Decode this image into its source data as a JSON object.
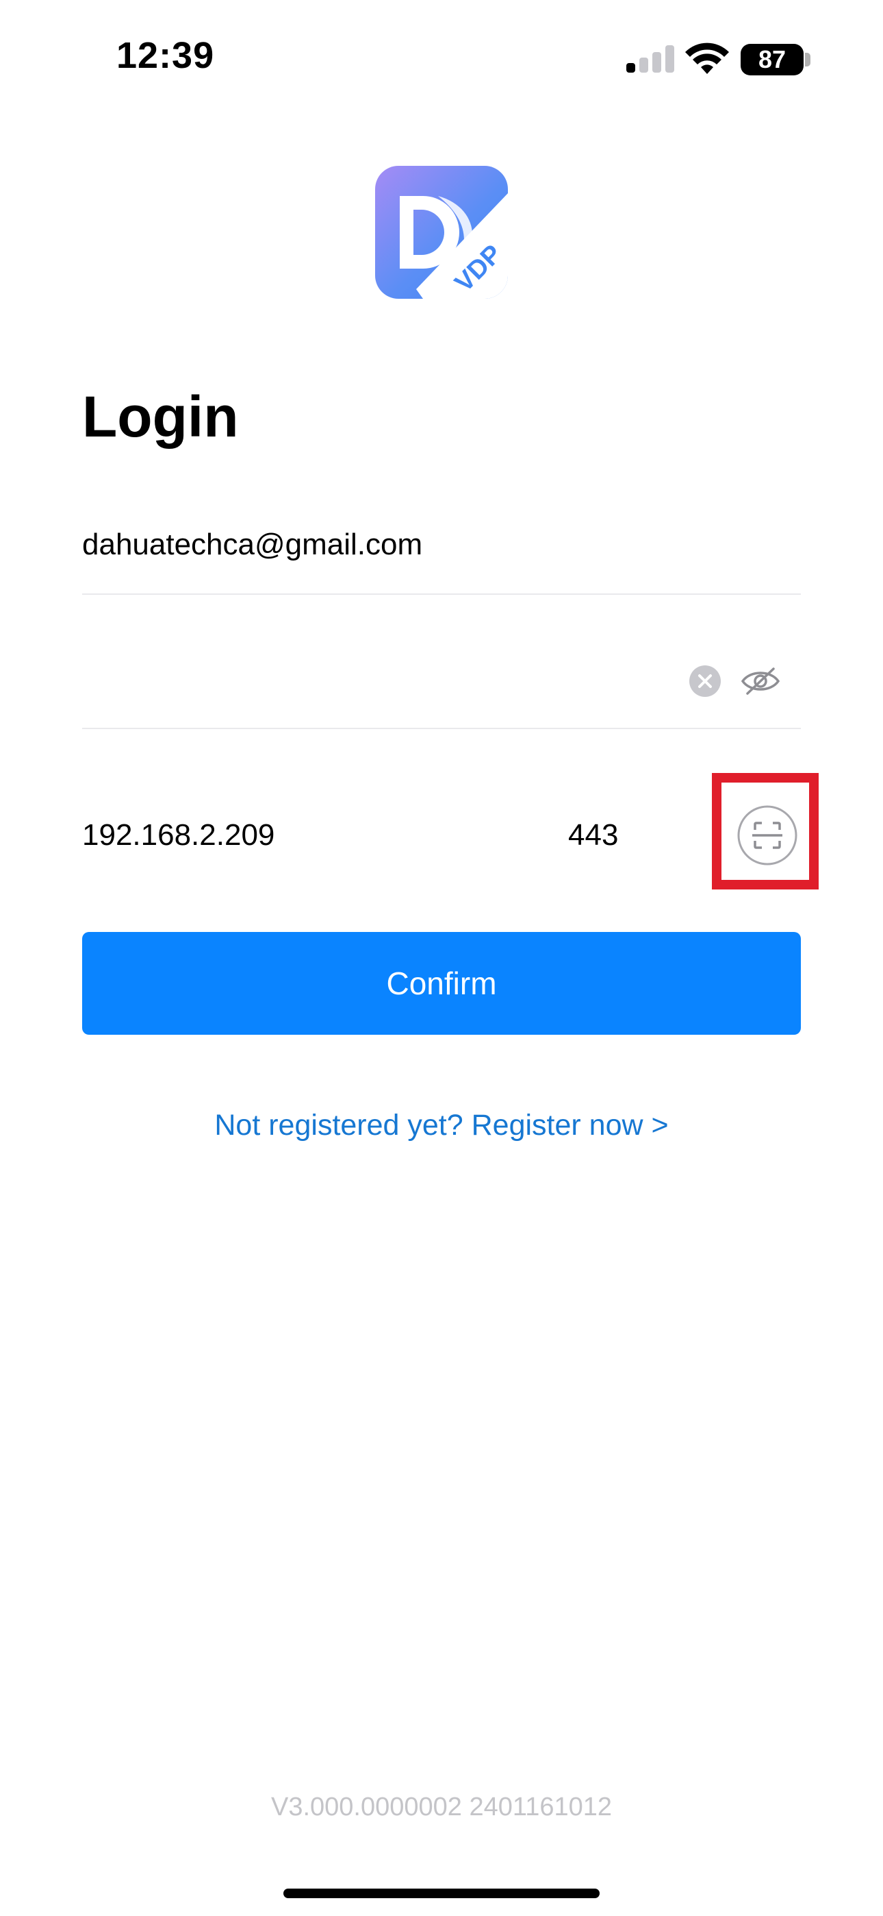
{
  "status_bar": {
    "time": "12:39",
    "battery": "87",
    "signal_bars_active": 1,
    "signal_bars_total": 4
  },
  "app": {
    "logo_text": "VDP"
  },
  "login": {
    "title": "Login",
    "email_value": "dahuatechca@gmail.com",
    "password_value": "",
    "server_ip": "192.168.2.209",
    "server_port": "443",
    "confirm_label": "Confirm",
    "register_link": "Not registered yet? Register now >"
  },
  "footer": {
    "version": "V3.000.0000002 2401161012"
  },
  "colors": {
    "accent": "#0a84ff",
    "link": "#1677d2",
    "highlight": "#e01e2b"
  },
  "icons": [
    "clear-icon",
    "eye-off-icon",
    "scan-icon",
    "wifi-icon",
    "signal-icon",
    "battery-icon"
  ]
}
